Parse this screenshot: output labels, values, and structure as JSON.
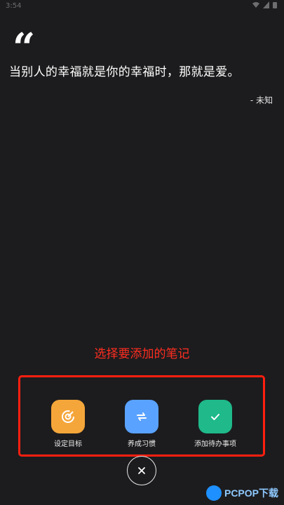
{
  "status": {
    "time": "3:54"
  },
  "quote": {
    "mark": "“",
    "text": "当别人的幸福就是你的幸福时，那就是爱。",
    "author": "- 未知"
  },
  "hint": "选择要添加的笔记",
  "actions": [
    {
      "label": "设定目标",
      "color": "#f5a63a",
      "icon": "target-icon"
    },
    {
      "label": "养成习惯",
      "color": "#5aa2ff",
      "icon": "repeat-icon"
    },
    {
      "label": "添加待办事项",
      "color": "#1fb98a",
      "icon": "check-icon"
    }
  ],
  "close_icon": "close-icon",
  "watermark": "PCPOP下载"
}
